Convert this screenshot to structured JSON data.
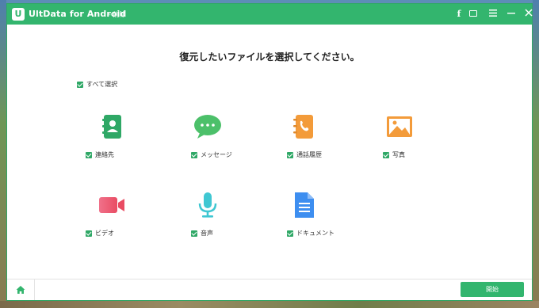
{
  "window": {
    "logo_letter": "U",
    "title": "UltData for Android",
    "subtitle": "- 削除",
    "facebook_label": "f"
  },
  "heading": "復元したいファイルを選択してください。",
  "select_all": "すべて選択",
  "categories": [
    {
      "label": "連絡先",
      "icon": "contacts-icon",
      "checked": true
    },
    {
      "label": "メッセージ",
      "icon": "message-icon",
      "checked": true
    },
    {
      "label": "通話履歴",
      "icon": "call-log-icon",
      "checked": true
    },
    {
      "label": "写真",
      "icon": "photo-icon",
      "checked": true
    },
    {
      "label": "ビデオ",
      "icon": "video-icon",
      "checked": true
    },
    {
      "label": "音声",
      "icon": "microphone-icon",
      "checked": true
    },
    {
      "label": "ドキュメント",
      "icon": "document-icon",
      "checked": true
    }
  ],
  "footer": {
    "start_label": "開始"
  },
  "colors": {
    "brand_green": "#33b56e"
  }
}
